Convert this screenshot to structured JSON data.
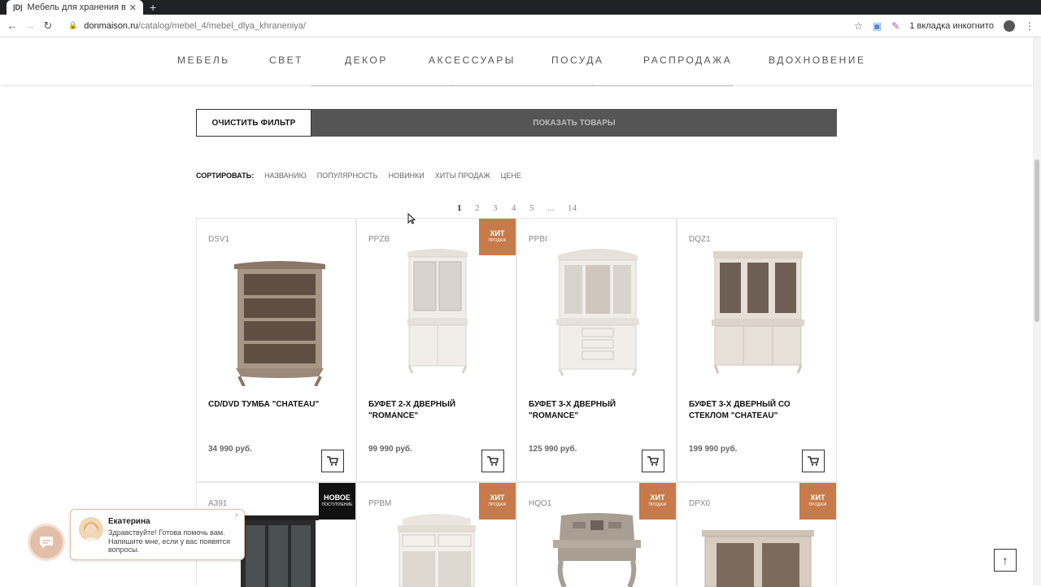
{
  "browser": {
    "tab_title": "Мебель для хранения в",
    "tab_favicon": "|D|",
    "url_host": "donmaison.ru",
    "url_path": "/catalog/mebel_4/mebel_dlya_khraneniya/",
    "incognito_label": "1 вкладка инкогнито"
  },
  "nav": {
    "items": [
      "МЕБЕЛЬ",
      "СВЕТ",
      "ДЕКОР",
      "АКСЕССУАРЫ",
      "ПОСУДА",
      "РАСПРОДАЖА",
      "ВДОХНОВЕНИЕ"
    ]
  },
  "filter": {
    "clear_label": "ОЧИСТИТЬ ФИЛЬТР",
    "show_label": "ПОКАЗАТЬ ТОВАРЫ"
  },
  "sort": {
    "label": "СОРТИРОВАТЬ:",
    "options": [
      "НАЗВАНИЮ",
      "ПОПУЛЯРНОСТЬ",
      "НОВИНКИ",
      "ХИТЫ ПРОДАЖ",
      "ЦЕНЕ"
    ]
  },
  "pagination": {
    "pages": [
      "1",
      "2",
      "3",
      "4",
      "5",
      "...",
      "14"
    ],
    "current": "1"
  },
  "badges": {
    "hit_big": "ХИТ",
    "hit_small": "ПРОДАЖ",
    "new_big": "НОВОЕ",
    "new_small": "ПОСТУПЛЕНИЕ"
  },
  "products": [
    {
      "sku": "DSV1",
      "name": "CD/DVD ТУМБА \"CHATEAU\"",
      "price": "34 990 руб.",
      "badge": ""
    },
    {
      "sku": "PPZB",
      "name": "БУФЕТ 2-Х ДВЕРНЫЙ \"ROMANCE\"",
      "price": "99 990 руб.",
      "badge": "hit"
    },
    {
      "sku": "PPBI",
      "name": "БУФЕТ 3-Х ДВЕРНЫЙ \"ROMANCE\"",
      "price": "125 990 руб.",
      "badge": ""
    },
    {
      "sku": "DQZ1",
      "name": "БУФЕТ 3-Х ДВЕРНЫЙ СО СТЕКЛОМ \"CHATEAU\"",
      "price": "199 990 руб.",
      "badge": ""
    },
    {
      "sku": "A391",
      "name": "",
      "price": "",
      "badge": "new"
    },
    {
      "sku": "PPBM",
      "name": "",
      "price": "",
      "badge": "hit"
    },
    {
      "sku": "HQO1",
      "name": "",
      "price": "",
      "badge": "hit"
    },
    {
      "sku": "DPX0",
      "name": "",
      "price": "",
      "badge": "hit"
    }
  ],
  "chat": {
    "agent_name": "Екатерина",
    "message": "Здравствуйте! Готова помочь вам. Напишите мне, если у вас появятся вопросы.",
    "close": "×"
  },
  "icons": {
    "cart": "cart-icon",
    "scroll_top": "arrow-up-icon",
    "chat": "chat-icon"
  },
  "colors": {
    "hit_badge": "#c77a4a",
    "new_badge": "#111111",
    "show_button": "#555555"
  }
}
